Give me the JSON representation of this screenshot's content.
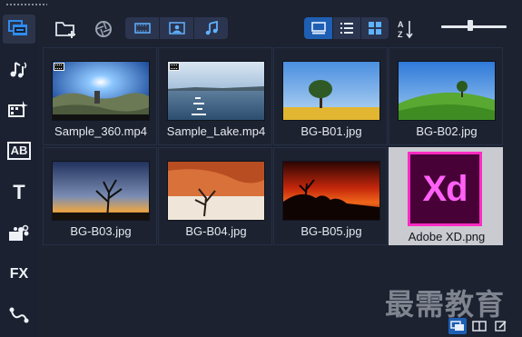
{
  "sidebar": {
    "items": [
      {
        "icon": "media-library-icon",
        "active": true
      },
      {
        "icon": "audio-music-icon",
        "active": false
      },
      {
        "icon": "instant-project-icon",
        "active": false
      },
      {
        "icon": "template-icon",
        "label": "AB",
        "active": false
      },
      {
        "icon": "title-icon",
        "label": "T",
        "active": false
      },
      {
        "icon": "transition-icon",
        "active": false
      },
      {
        "icon": "filter-icon",
        "label": "FX",
        "active": false
      },
      {
        "icon": "path-motion-icon",
        "active": false
      }
    ]
  },
  "toolbar": {
    "import_icon": "folder-add-icon",
    "capture_icon": "aperture-icon",
    "filter_buttons": [
      {
        "icon": "video-filter-icon",
        "on": true
      },
      {
        "icon": "photo-filter-icon",
        "on": true
      },
      {
        "icon": "audio-filter-icon",
        "on": true
      }
    ],
    "view_buttons": [
      {
        "icon": "thumbnail-view-icon",
        "on": true
      },
      {
        "icon": "list-view-icon",
        "on": false
      },
      {
        "icon": "grid-view-icon",
        "on": false
      }
    ],
    "sort_icon": "sort-az-icon",
    "zoom_level": 0.45
  },
  "media": [
    {
      "name": "Sample_360.mp4",
      "type": "video",
      "thumb": "panorama"
    },
    {
      "name": "Sample_Lake.mp4",
      "type": "video",
      "thumb": "lake"
    },
    {
      "name": "BG-B01.jpg",
      "type": "image",
      "thumb": "tree-field"
    },
    {
      "name": "BG-B02.jpg",
      "type": "image",
      "thumb": "green-hill"
    },
    {
      "name": "BG-B03.jpg",
      "type": "image",
      "thumb": "dusk-tree"
    },
    {
      "name": "BG-B04.jpg",
      "type": "image",
      "thumb": "desert"
    },
    {
      "name": "BG-B05.jpg",
      "type": "image",
      "thumb": "red-sunset"
    },
    {
      "name": "Adobe XD.png",
      "type": "image",
      "thumb": "adobe-xd",
      "selected": true,
      "logo_text": "Xd"
    }
  ],
  "watermark": "最需教育",
  "bottom_bar": [
    {
      "icon": "library-panel-icon",
      "on": true
    },
    {
      "icon": "split-view-icon",
      "on": false
    },
    {
      "icon": "edit-icon",
      "on": false
    }
  ],
  "colors": {
    "accent": "#1e5fb3",
    "background": "#1c2230",
    "xd_pink": "#ff61f6",
    "xd_bg": "#470137"
  }
}
